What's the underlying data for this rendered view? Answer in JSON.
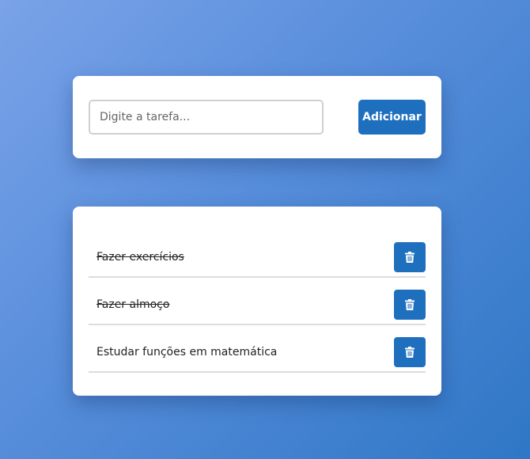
{
  "form": {
    "placeholder": "Digite a tarefa...",
    "value": "",
    "add_label": "Adicionar"
  },
  "tasks": [
    {
      "text": "Fazer exercícios",
      "done": true
    },
    {
      "text": "Fazer almoço",
      "done": true
    },
    {
      "text": "Estudar funções em matemática",
      "done": false
    }
  ],
  "icons": {
    "delete": "trash-icon"
  },
  "colors": {
    "accent": "#1f6fbf",
    "background_start": "#7aa3e8",
    "background_end": "#2f77c6"
  }
}
